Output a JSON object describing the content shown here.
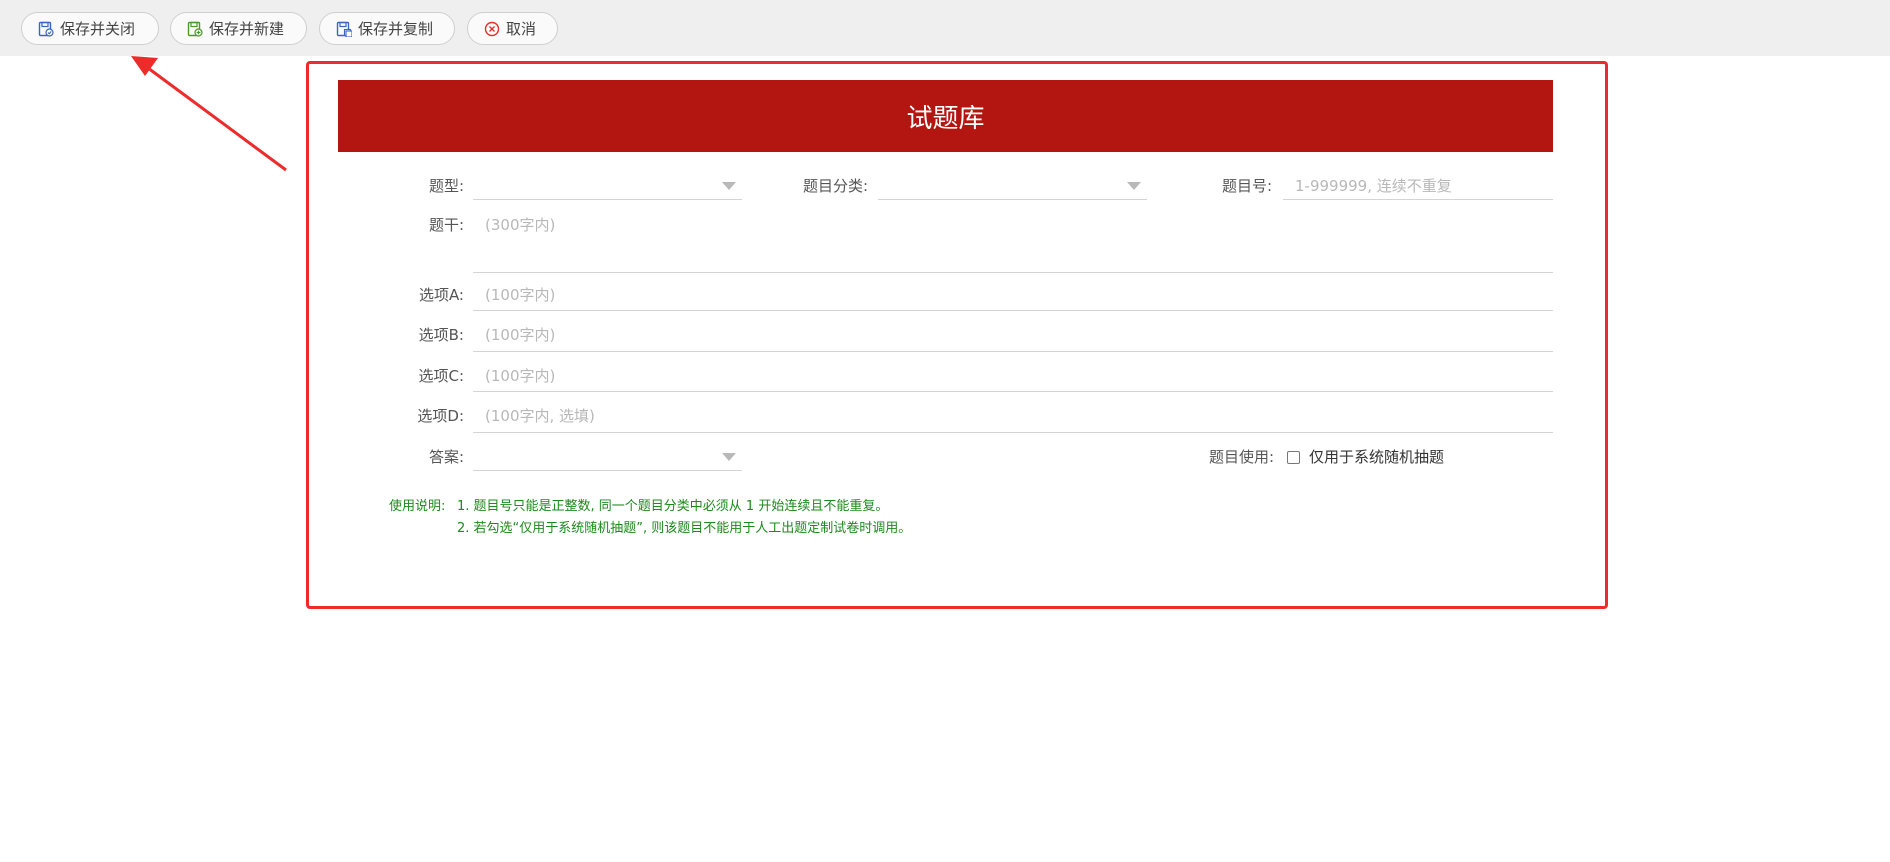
{
  "toolbar": {
    "buttons": [
      {
        "label": "保存并关闭",
        "icon": "save-close-icon"
      },
      {
        "label": "保存并新建",
        "icon": "save-new-icon"
      },
      {
        "label": "保存并复制",
        "icon": "save-copy-icon"
      },
      {
        "label": "取消",
        "icon": "cancel-icon"
      }
    ]
  },
  "colors": {
    "header_bg": "#b31510",
    "annotation_red": "#ee2b2b",
    "note_green": "#1c8a1c"
  },
  "form": {
    "title": "试题库",
    "fields": {
      "type": {
        "label": "题型:",
        "value": ""
      },
      "category": {
        "label": "题目分类:",
        "value": ""
      },
      "number": {
        "label": "题目号:",
        "placeholder": "1-999999, 连续不重复"
      },
      "stem": {
        "label": "题干:",
        "placeholder": "(300字内)"
      },
      "option_a": {
        "label": "选项A:",
        "placeholder": "(100字内)"
      },
      "option_b": {
        "label": "选项B:",
        "placeholder": "(100字内)"
      },
      "option_c": {
        "label": "选项C:",
        "placeholder": "(100字内)"
      },
      "option_d": {
        "label": "选项D:",
        "placeholder": "(100字内, 选填)"
      },
      "answer": {
        "label": "答案:",
        "value": ""
      },
      "usage": {
        "label": "题目使用:",
        "checkbox_label": "仅用于系统随机抽题",
        "checked": false
      }
    },
    "notes": {
      "title": "使用说明:",
      "items": [
        "1. 题目号只能是正整数, 同一个题目分类中必须从 1 开始连续且不能重复。",
        "2. 若勾选“仅用于系统随机抽题”, 则该题目不能用于人工出题定制试卷时调用。"
      ]
    }
  }
}
